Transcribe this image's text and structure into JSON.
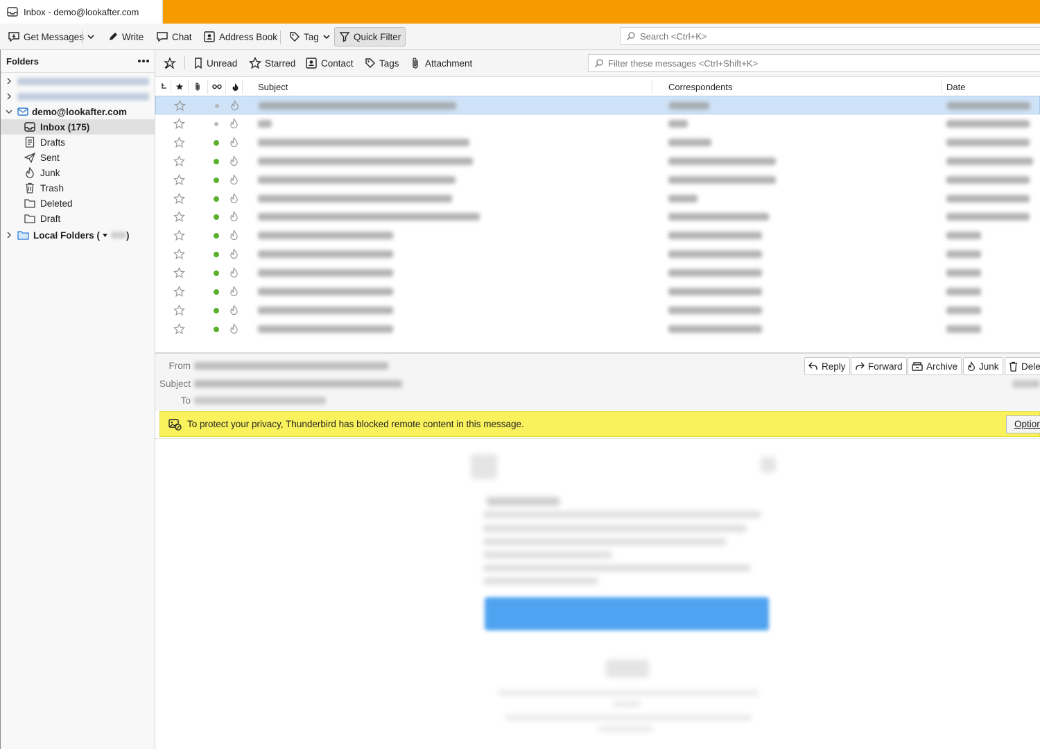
{
  "tab": {
    "title": "Inbox - demo@lookafter.com",
    "icon": "inbox-icon"
  },
  "toolbar": {
    "get_messages": "Get Messages",
    "write": "Write",
    "chat": "Chat",
    "address_book": "Address Book",
    "tag": "Tag",
    "quick_filter": "Quick Filter",
    "search_placeholder": "Search <Ctrl+K>"
  },
  "folder_pane": {
    "header": "Folders",
    "account": "demo@lookafter.com",
    "folders": [
      {
        "label": "Inbox (175)",
        "icon": "inbox-icon"
      },
      {
        "label": "Drafts",
        "icon": "drafts-icon"
      },
      {
        "label": "Sent",
        "icon": "sent-icon"
      },
      {
        "label": "Junk",
        "icon": "junk-icon"
      },
      {
        "label": "Trash",
        "icon": "trash-icon"
      },
      {
        "label": "Deleted",
        "icon": "folder-icon"
      },
      {
        "label": "Draft",
        "icon": "folder-icon"
      }
    ],
    "local_folders_prefix": "Local Folders (",
    "local_folders_suffix": ")"
  },
  "quick_filter_bar": {
    "unread": "Unread",
    "starred": "Starred",
    "contact": "Contact",
    "tags": "Tags",
    "attachment": "Attachment",
    "filter_placeholder": "Filter these messages <Ctrl+Shift+K>"
  },
  "thread_columns": {
    "subject": "Subject",
    "correspondents": "Correspondents",
    "date": "Date"
  },
  "messages": {
    "row_count": 13,
    "unread_dot_color": "#59b02c",
    "read_dot_color": "#b8b8b8"
  },
  "message_header": {
    "from_label": "From",
    "subject_label": "Subject",
    "to_label": "To",
    "reply": "Reply",
    "forward": "Forward",
    "archive": "Archive",
    "junk": "Junk",
    "delete": "Dele"
  },
  "remote_content": {
    "message": "To protect your privacy, Thunderbird has blocked remote content in this message.",
    "options": "Option"
  },
  "colors": {
    "tabbar": "#f59b00",
    "notice": "#f9f25c",
    "selection": "#cfe3f8",
    "body_button": "#4fa3f0"
  }
}
